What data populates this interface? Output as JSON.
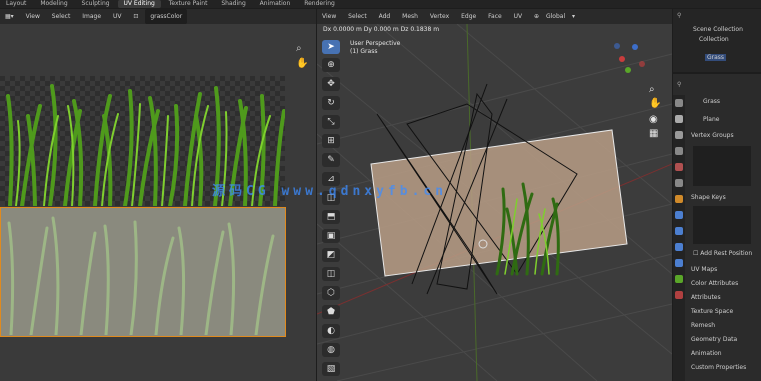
{
  "topbar": {
    "menus": [
      "Layout",
      "Modeling",
      "Sculpting",
      "UV Editing",
      "Texture Paint",
      "Shading",
      "Animation",
      "Rendering"
    ],
    "active": "UV Editing"
  },
  "uv_header": {
    "items": [
      "View",
      "Select",
      "Image",
      "UV"
    ],
    "image_name": "grassColor"
  },
  "viewport_header": {
    "items": [
      "View",
      "Select",
      "Add",
      "Mesh",
      "Vertex",
      "Edge",
      "Face",
      "UV"
    ],
    "orientation": "Global"
  },
  "viewport_info": {
    "line1": "User Perspective",
    "line2": "(1) Grass",
    "dims": "Dx 0.0000 m  Dy 0.000 m  Dz 0.1838 m"
  },
  "outliner": {
    "items": [
      "Scene Collection",
      "Collection",
      "Grass"
    ]
  },
  "properties": {
    "object_name": "Grass",
    "data_name": "Plane",
    "sections": [
      "Vertex Groups",
      "Shape Keys",
      "UV Maps",
      "Color Attributes",
      "Attributes",
      "Texture Space",
      "Remesh",
      "Geometry Data",
      "Animation",
      "Custom Properties"
    ],
    "checkbox_label": "Add Rest Position"
  },
  "watermark": "源码CG www.qdnxyfb.cn",
  "colors": {
    "accent": "#4772b3",
    "selection": "#e08a1e",
    "grass_dark": "#2f6b12",
    "grass_light": "#7fcf2e",
    "plane": "#b89e86"
  }
}
